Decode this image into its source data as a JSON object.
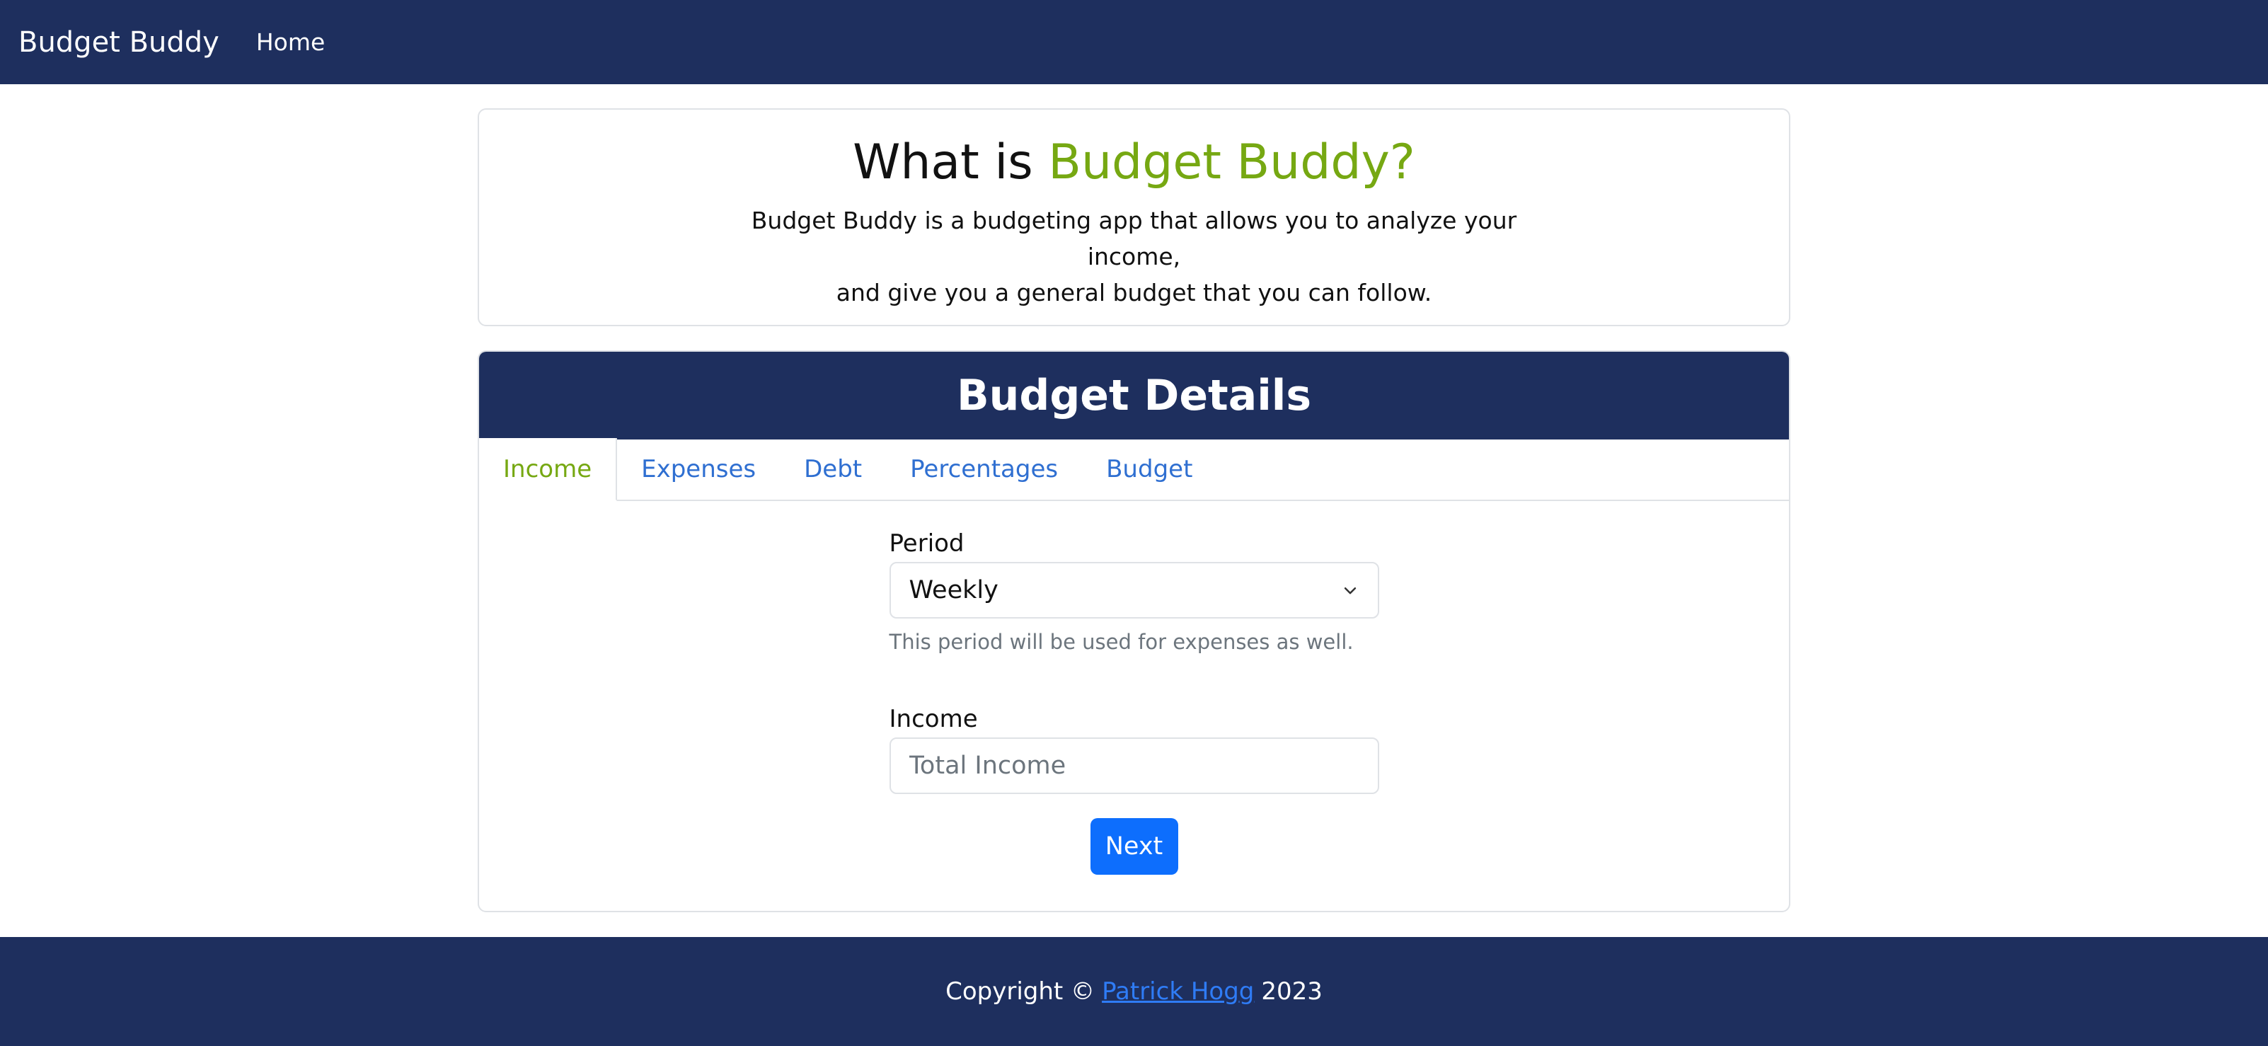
{
  "navbar": {
    "brand": "Budget Buddy",
    "links": [
      {
        "label": "Home"
      }
    ]
  },
  "intro": {
    "title_prefix": "What is ",
    "title_accent": "Budget Buddy?",
    "description_line1": "Budget Buddy is a budgeting app that allows you to analyze your income,",
    "description_line2": "and give you a general budget that you can follow."
  },
  "details": {
    "header": "Budget Details",
    "tabs": [
      {
        "label": "Income",
        "active": true
      },
      {
        "label": "Expenses",
        "active": false
      },
      {
        "label": "Debt",
        "active": false
      },
      {
        "label": "Percentages",
        "active": false
      },
      {
        "label": "Budget",
        "active": false
      }
    ],
    "period": {
      "label": "Period",
      "selected": "Weekly",
      "help": "This period will be used for expenses as well."
    },
    "income": {
      "label": "Income",
      "value": "",
      "placeholder": "Total Income"
    },
    "next_label": "Next"
  },
  "footer": {
    "prefix": "Copyright ©",
    "author": "Patrick Hogg",
    "year": "2023"
  },
  "colors": {
    "navy": "#1e2f5e",
    "accent_green": "#76a812",
    "link_blue": "#2f6fd1",
    "button_blue": "#0d6efd"
  },
  "icons": {
    "select": "chevron-down-icon"
  }
}
